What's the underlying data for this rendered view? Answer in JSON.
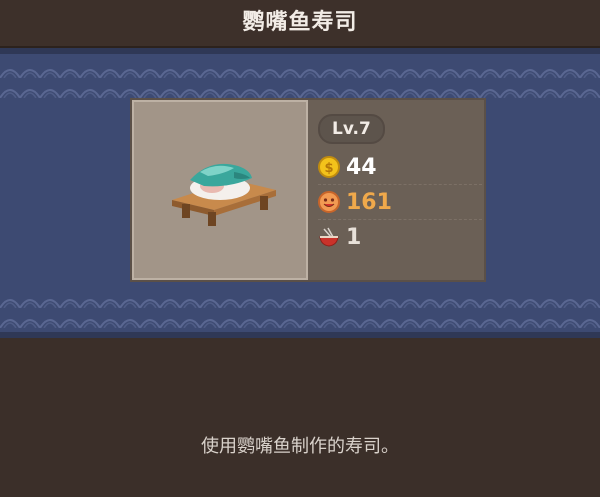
{
  "title": "鹦嘴鱼寿司",
  "item": {
    "level": "Lv.7",
    "price": "44",
    "popularity": "161",
    "bowl_count": "1",
    "icons": [
      "coin-icon",
      "smiley-face-icon",
      "bowl-icon",
      "sushi-icon"
    ]
  },
  "description": "使用鹦嘴鱼制作的寿司。",
  "colors": {
    "banner": "#3d4a72",
    "panel": "#6b6056",
    "tile": "#a29588",
    "accent_gold": "#f0a94b"
  }
}
